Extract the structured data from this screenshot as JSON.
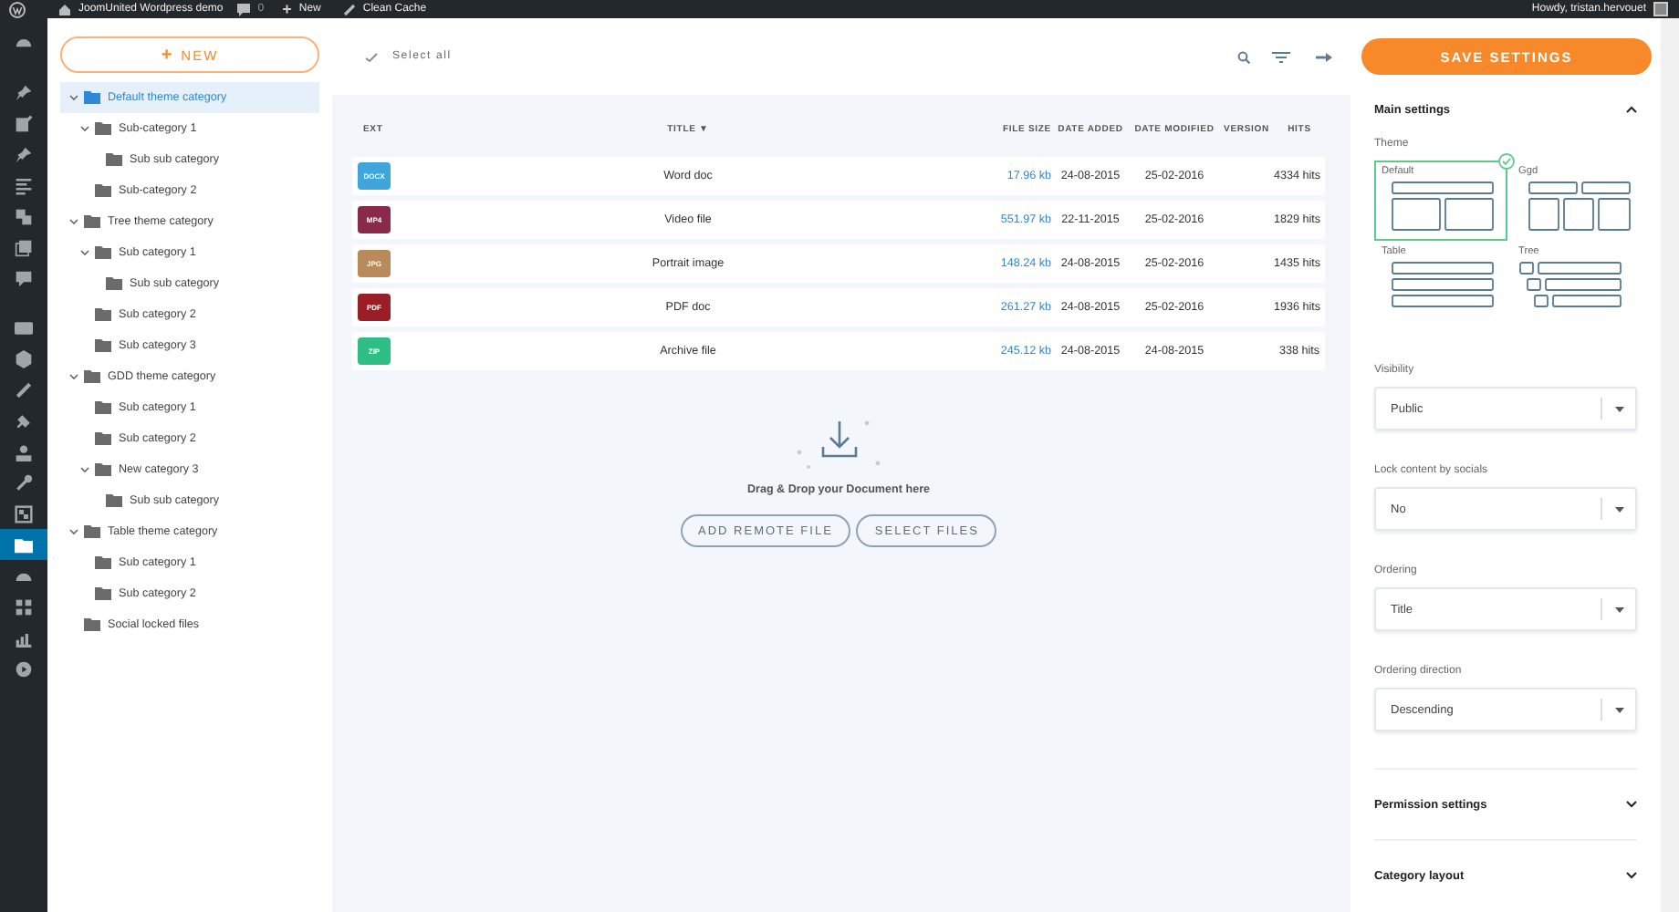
{
  "admin_bar": {
    "site_title": "JoomUnited Wordpress demo",
    "comments": "0",
    "new_icon": "+",
    "new": "New",
    "clean_cache": "Clean Cache",
    "greeting": "Howdy, tristan.hervouet"
  },
  "admin_menu": [
    {
      "selected": false
    },
    {
      "selected": false
    },
    {
      "selected": false
    },
    {
      "selected": false
    },
    {
      "selected": false
    },
    {
      "selected": false
    },
    {
      "selected": false
    },
    {
      "selected": false
    },
    {
      "selected": false
    },
    {
      "selected": false
    },
    {
      "selected": false
    },
    {
      "selected": false
    },
    {
      "selected": false
    },
    {
      "selected": false
    },
    {
      "selected": false
    },
    {
      "selected": true
    },
    {
      "selected": false
    },
    {
      "selected": false
    },
    {
      "selected": false
    },
    {
      "selected": false
    }
  ],
  "categories": {
    "new_button": {
      "icon": "+",
      "label": "NEW"
    },
    "tree": [
      {
        "label": "Default theme category",
        "selected": true,
        "expanded": true,
        "children": [
          {
            "label": "Sub-category 1",
            "selected": false,
            "expanded": true,
            "children": [
              {
                "label": "Sub sub category",
                "selected": false
              }
            ]
          },
          {
            "label": "Sub-category 2",
            "selected": false
          }
        ]
      },
      {
        "label": "Tree theme category",
        "selected": false,
        "expanded": true,
        "children": [
          {
            "label": "Sub category 1",
            "selected": false,
            "expanded": true,
            "children": [
              {
                "label": "Sub sub category",
                "selected": false
              }
            ]
          },
          {
            "label": "Sub category 2",
            "selected": false
          },
          {
            "label": "Sub category 3",
            "selected": false
          }
        ]
      },
      {
        "label": "GDD theme category",
        "selected": false,
        "expanded": true,
        "children": [
          {
            "label": "Sub category 1",
            "selected": false
          },
          {
            "label": "Sub category 2",
            "selected": false
          },
          {
            "label": "New category 3",
            "selected": false,
            "expanded": true,
            "children": [
              {
                "label": "Sub sub category",
                "selected": false
              }
            ]
          }
        ]
      },
      {
        "label": "Table theme category",
        "selected": false,
        "expanded": true,
        "children": [
          {
            "label": "Sub category 1",
            "selected": false
          },
          {
            "label": "Sub category 2",
            "selected": false
          }
        ]
      },
      {
        "label": "Social locked files",
        "selected": false
      }
    ]
  },
  "toolbar": {
    "select_all": "Select all"
  },
  "files": {
    "columns": [
      {
        "label": "EXT"
      },
      {
        "label": "TITLE",
        "sort_mark": "▼"
      },
      {
        "label": "FILE SIZE"
      },
      {
        "label": "DATE ADDED"
      },
      {
        "label": "DATE MODIFIED"
      },
      {
        "label": "VERSION"
      },
      {
        "label": "HITS"
      }
    ],
    "rows": [
      {
        "ext": "DOCX",
        "color": "#3fa6dc",
        "title": "Word doc",
        "size": "17.96 kb",
        "added": "24-08-2015",
        "modified": "25-02-2016",
        "hits": "4334 hits"
      },
      {
        "ext": "MP4",
        "color": "#8a2a4a",
        "title": "Video file",
        "size": "551.97 kb",
        "added": "22-11-2015",
        "modified": "25-02-2016",
        "hits": "1829 hits"
      },
      {
        "ext": "JPG",
        "color": "#b98a5a",
        "title": "Portrait image",
        "size": "148.24 kb",
        "added": "24-08-2015",
        "modified": "25-02-2016",
        "hits": "1435 hits"
      },
      {
        "ext": "PDF",
        "color": "#9a1e26",
        "title": "PDF doc",
        "size": "261.27 kb",
        "added": "24-08-2015",
        "modified": "25-02-2016",
        "hits": "1936 hits"
      },
      {
        "ext": "ZIP",
        "color": "#2fbf86",
        "title": "Archive file",
        "size": "245.12 kb",
        "added": "24-08-2015",
        "modified": "24-08-2015",
        "hits": "338 hits"
      }
    ]
  },
  "upload": {
    "hint": "Drag & Drop your Document here",
    "buttons": [
      "ADD REMOTE FILE",
      "SELECT FILES"
    ]
  },
  "settings": {
    "save_button": "SAVE SETTINGS",
    "main": {
      "title": "Main settings",
      "expanded": true,
      "theme_label": "Theme",
      "themes": [
        {
          "label": "Default",
          "kind": "default",
          "selected": true
        },
        {
          "label": "Ggd",
          "kind": "grid",
          "selected": false
        },
        {
          "label": "Table",
          "kind": "table",
          "selected": false
        },
        {
          "label": "Tree",
          "kind": "tree",
          "selected": false
        }
      ],
      "fields": [
        {
          "label": "Visibility",
          "value": "Public"
        },
        {
          "label": "Lock content by socials",
          "value": "No"
        },
        {
          "label": "Ordering",
          "value": "Title"
        },
        {
          "label": "Ordering direction",
          "value": "Descending"
        }
      ]
    },
    "sections": [
      {
        "title": "Permission settings",
        "expanded": false
      },
      {
        "title": "Category layout",
        "expanded": false
      }
    ]
  }
}
